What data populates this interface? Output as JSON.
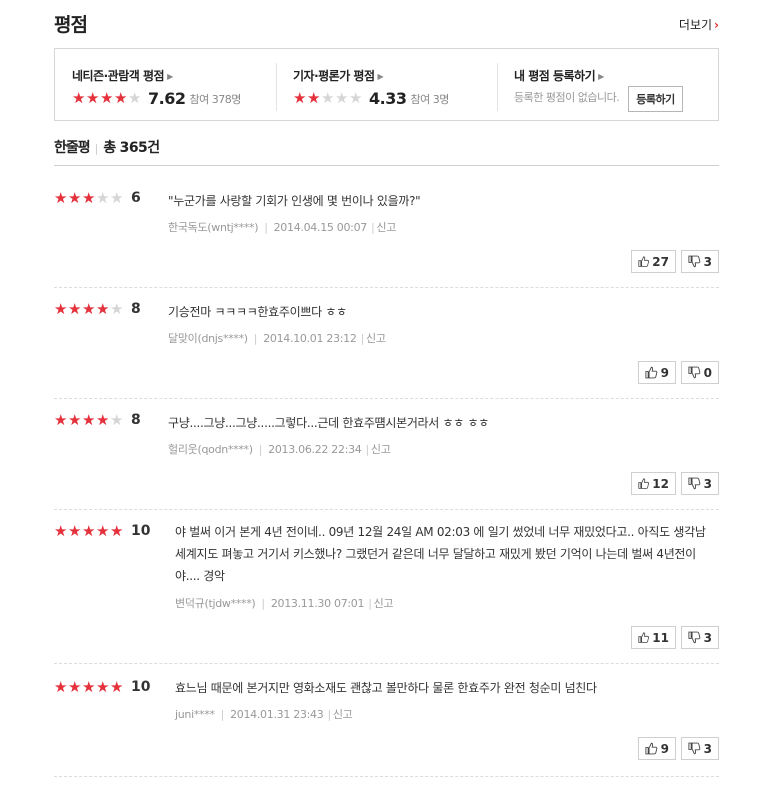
{
  "header": {
    "title": "평점",
    "more_label": "더보기"
  },
  "summary": {
    "netizen": {
      "label": "네티즌·관람객 평점",
      "stars": 4,
      "score": "7.62",
      "participants": "참여 378명"
    },
    "critic": {
      "label": "기자·평론가 평점",
      "stars": 2,
      "score": "4.33",
      "participants": "참여 3명"
    },
    "mine": {
      "label": "내 평점 등록하기",
      "empty_text": "등록한 평점이 없습니다.",
      "button_label": "등록하기"
    }
  },
  "list": {
    "title": "한줄평",
    "total_label": "총",
    "total_count": "365건"
  },
  "reviews": [
    {
      "stars": 3,
      "score": "6",
      "text": "\"누군가를 사랑할 기회가 인생에 몇 번이나 있을까?\"",
      "user": "한국독도(wntj****)",
      "date": "2014.04.15 00:07",
      "report": "신고",
      "likes": "27",
      "dislikes": "3"
    },
    {
      "stars": 4,
      "score": "8",
      "text": "기승전마 ㅋㅋㅋㅋ한효주이쁘다 ㅎㅎ",
      "user": "달맞이(dnjs****)",
      "date": "2014.10.01 23:12",
      "report": "신고",
      "likes": "9",
      "dislikes": "0"
    },
    {
      "stars": 4,
      "score": "8",
      "text": "구냥....그냥...그냥.....그렇다...근데 한효주떔시본거라서 ㅎㅎ ㅎㅎ",
      "user": "헐리웃(qodn****)",
      "date": "2013.06.22 22:34",
      "report": "신고",
      "likes": "12",
      "dislikes": "3"
    },
    {
      "stars": 5,
      "score": "10",
      "text": "야 벌써 이거 본게 4년 전이네.. 09년 12월 24일 AM 02:03 에 일기 썼었네 너무 재밌었다고.. 아직도 생각남 세계지도 펴놓고 거기서 키스했나? 그랬던거 같은데 너무 달달하고 재밌게 봤던 기억이 나는데 벌써 4년전이야.... 경악",
      "user": "변덕규(tjdw****)",
      "date": "2013.11.30 07:01",
      "report": "신고",
      "likes": "11",
      "dislikes": "3"
    },
    {
      "stars": 5,
      "score": "10",
      "text": "효느님 때문에 본거지만 영화소재도 괜찮고 볼만하다 물론 한효주가 완전 청순미 넘친다",
      "user": "juni****",
      "date": "2014.01.31 23:43",
      "report": "신고",
      "likes": "9",
      "dislikes": "3"
    }
  ],
  "colors": {
    "star_on": "#e4313b",
    "star_off": "#d6d6d6",
    "accent": "#e03030"
  },
  "icons": {
    "like": "thumb-up-icon",
    "dislike": "thumb-down-icon"
  }
}
